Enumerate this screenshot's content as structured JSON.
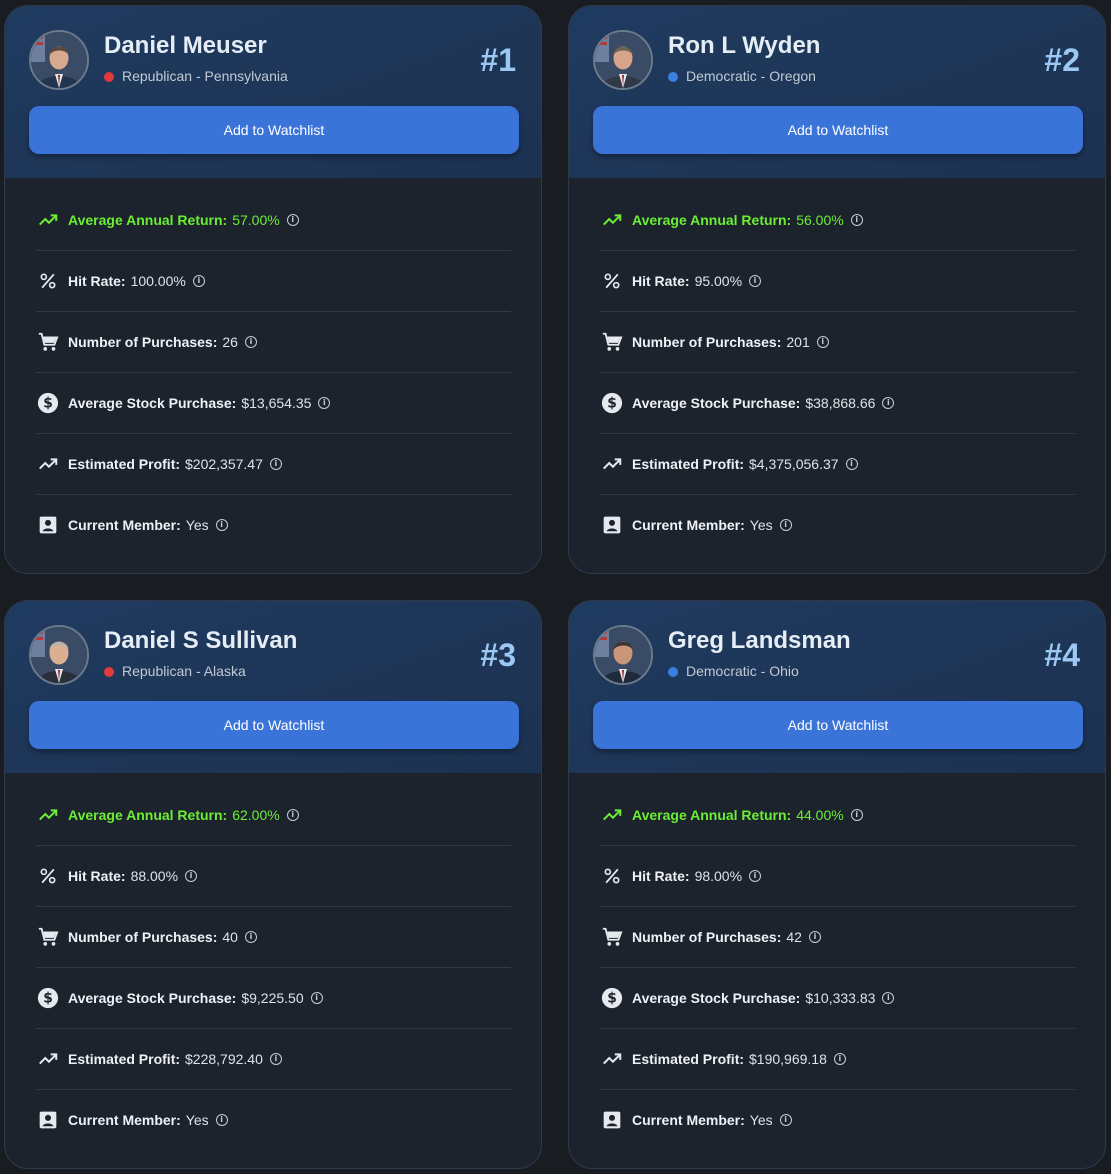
{
  "colors": {
    "republican": "#e03a3a",
    "democratic": "#3b7fe0",
    "accent_green": "#6bee34",
    "button": "#3a74d9"
  },
  "cards": [
    {
      "name": "Daniel Meuser",
      "party_state": "Republican - Pennsylvania",
      "party": "republican",
      "rank": "#1",
      "button_label": "Add to Watchlist",
      "stats": [
        {
          "icon": "trending-up-icon",
          "label": "Average Annual Return:",
          "value": "57.00%"
        },
        {
          "icon": "percent-icon",
          "label": "Hit Rate:",
          "value": "100.00%"
        },
        {
          "icon": "cart-icon",
          "label": "Number of Purchases:",
          "value": "26"
        },
        {
          "icon": "dollar-icon",
          "label": "Average Stock Purchase:",
          "value": "$13,654.35"
        },
        {
          "icon": "trending-up-icon",
          "label": "Estimated Profit:",
          "value": "$202,357.47"
        },
        {
          "icon": "person-icon",
          "label": "Current Member:",
          "value": "Yes"
        }
      ]
    },
    {
      "name": "Ron L Wyden",
      "party_state": "Democratic - Oregon",
      "party": "democratic",
      "rank": "#2",
      "button_label": "Add to Watchlist",
      "stats": [
        {
          "icon": "trending-up-icon",
          "label": "Average Annual Return:",
          "value": "56.00%"
        },
        {
          "icon": "percent-icon",
          "label": "Hit Rate:",
          "value": "95.00%"
        },
        {
          "icon": "cart-icon",
          "label": "Number of Purchases:",
          "value": "201"
        },
        {
          "icon": "dollar-icon",
          "label": "Average Stock Purchase:",
          "value": "$38,868.66"
        },
        {
          "icon": "trending-up-icon",
          "label": "Estimated Profit:",
          "value": "$4,375,056.37"
        },
        {
          "icon": "person-icon",
          "label": "Current Member:",
          "value": "Yes"
        }
      ]
    },
    {
      "name": "Daniel S Sullivan",
      "party_state": "Republican - Alaska",
      "party": "republican",
      "rank": "#3",
      "button_label": "Add to Watchlist",
      "stats": [
        {
          "icon": "trending-up-icon",
          "label": "Average Annual Return:",
          "value": "62.00%"
        },
        {
          "icon": "percent-icon",
          "label": "Hit Rate:",
          "value": "88.00%"
        },
        {
          "icon": "cart-icon",
          "label": "Number of Purchases:",
          "value": "40"
        },
        {
          "icon": "dollar-icon",
          "label": "Average Stock Purchase:",
          "value": "$9,225.50"
        },
        {
          "icon": "trending-up-icon",
          "label": "Estimated Profit:",
          "value": "$228,792.40"
        },
        {
          "icon": "person-icon",
          "label": "Current Member:",
          "value": "Yes"
        }
      ]
    },
    {
      "name": "Greg Landsman",
      "party_state": "Democratic - Ohio",
      "party": "democratic",
      "rank": "#4",
      "button_label": "Add to Watchlist",
      "stats": [
        {
          "icon": "trending-up-icon",
          "label": "Average Annual Return:",
          "value": "44.00%"
        },
        {
          "icon": "percent-icon",
          "label": "Hit Rate:",
          "value": "98.00%"
        },
        {
          "icon": "cart-icon",
          "label": "Number of Purchases:",
          "value": "42"
        },
        {
          "icon": "dollar-icon",
          "label": "Average Stock Purchase:",
          "value": "$10,333.83"
        },
        {
          "icon": "trending-up-icon",
          "label": "Estimated Profit:",
          "value": "$190,969.18"
        },
        {
          "icon": "person-icon",
          "label": "Current Member:",
          "value": "Yes"
        }
      ]
    }
  ]
}
